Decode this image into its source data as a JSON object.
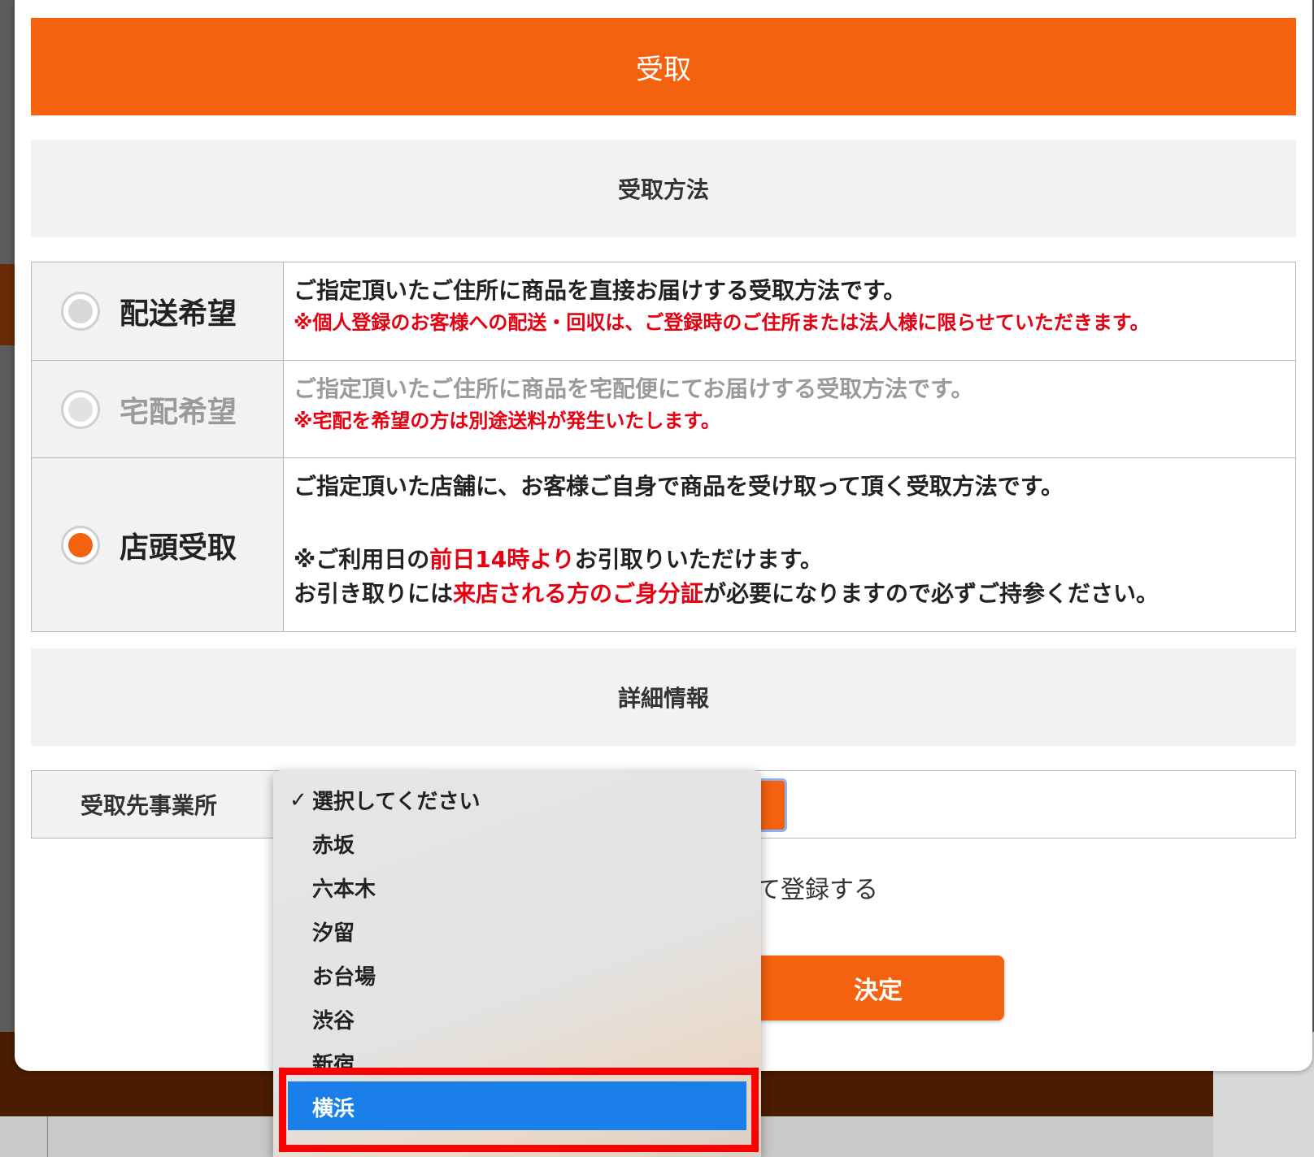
{
  "modal": {
    "title": "受取",
    "method_section_title": "受取方法",
    "details_section_title": "詳細情報"
  },
  "methods": [
    {
      "name": "配送希望",
      "selected": false,
      "disabled": false,
      "desc": "ご指定頂いたご住所に商品を直接お届けする受取方法です。",
      "note": "※個人登録のお客様への配送・回収は、ご登録時のご住所または法人様に限らせていただきます。"
    },
    {
      "name": "宅配希望",
      "selected": false,
      "disabled": true,
      "desc": "ご指定頂いたご住所に商品を宅配便にてお届けする受取方法です。",
      "note": "※宅配を希望の方は別途送料が発生いたします。"
    },
    {
      "name": "店頭受取",
      "selected": true,
      "disabled": false,
      "desc": "ご指定頂いた店舗に、お客様ご自身で商品を受け取って頂く受取方法です。",
      "note_line1_prefix": "※ご利用日の",
      "note_line1_red": "前日14時より",
      "note_line1_suffix": "お引取りいただけます。",
      "note_line2_prefix": "お引き取りには",
      "note_line2_red": "来店される方のご身分証",
      "note_line2_suffix": "が必要になりますので必ずご持参ください。"
    }
  ],
  "office": {
    "label": "受取先事業所",
    "register_text": "て登録する",
    "submit_label": "決定"
  },
  "dropdown": {
    "checkmark": "✓",
    "options": [
      "選択してください",
      "赤坂",
      "六本木",
      "汐留",
      "お台場",
      "渋谷",
      "新宿",
      "横浜"
    ],
    "checked_index": 0,
    "highlighted_index": 7
  },
  "colors": {
    "accent": "#f4610f",
    "warning": "#e60012",
    "highlight": "#1a7fe8",
    "annotation": "#ff0000"
  }
}
